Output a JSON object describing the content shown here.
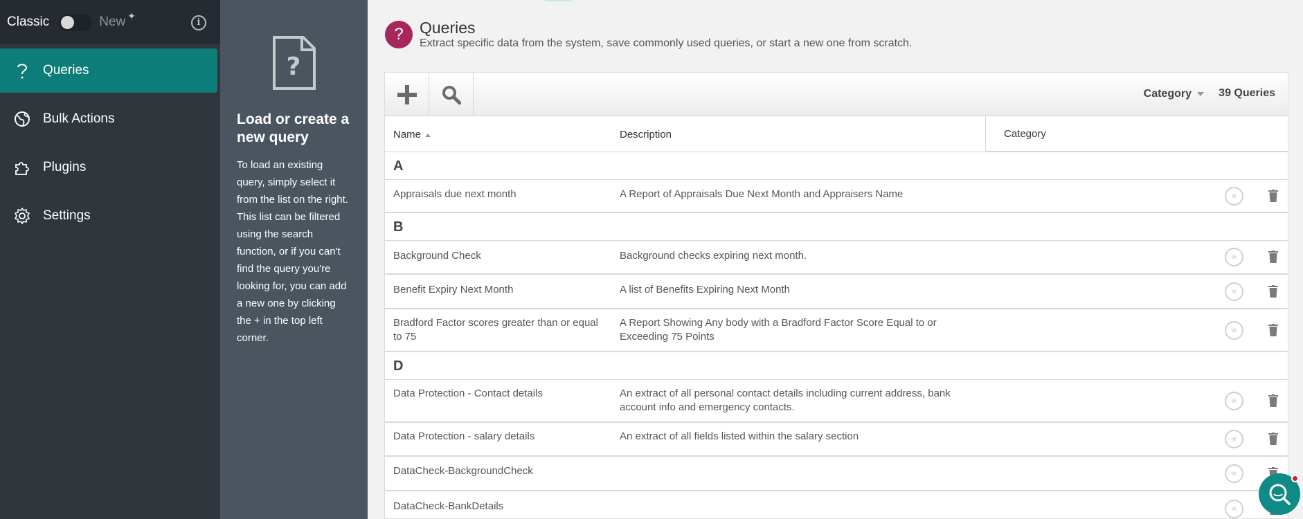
{
  "mode": {
    "classic_label": "Classic",
    "new_label": "New"
  },
  "nav": [
    {
      "label": "Queries",
      "icon": "question-icon",
      "active": true
    },
    {
      "label": "Bulk Actions",
      "icon": "globe-icon",
      "active": false
    },
    {
      "label": "Plugins",
      "icon": "puzzle-icon",
      "active": false
    },
    {
      "label": "Settings",
      "icon": "gear-icon",
      "active": false
    }
  ],
  "help": {
    "title": "Load or create a new query",
    "text": "To load an existing query, simply select it from the list on the right. This list can be filtered using the search function, or if you can't find the query you're looking for, you can add a new one by clicking the + in the top left corner."
  },
  "page": {
    "title": "Queries",
    "subtitle": "Extract specific data from the system, save commonly used queries, or start a new one from scratch."
  },
  "toolbar": {
    "category_label": "Category",
    "count_label": "39 Queries"
  },
  "columns": {
    "name": "Name",
    "description": "Description",
    "category": "Category"
  },
  "groups": [
    {
      "letter": "A",
      "rows": [
        {
          "name": "Appraisals due next month",
          "description": "A Report of Appraisals Due Next Month and Appraisers Name"
        }
      ]
    },
    {
      "letter": "B",
      "rows": [
        {
          "name": "Background Check",
          "description": "Background checks expiring next month."
        },
        {
          "name": "Benefit Expiry Next Month",
          "description": "A list of Benefits Expiring Next Month"
        },
        {
          "name": "Bradford Factor scores greater than or equal to 75",
          "description": "A Report Showing Any body with a Bradford Factor Score Equal to or Exceeding 75 Points"
        }
      ]
    },
    {
      "letter": "D",
      "rows": [
        {
          "name": "Data Protection - Contact details",
          "description": "An extract of all personal contact details including current address, bank account info and emergency contacts."
        },
        {
          "name": "Data Protection - salary details",
          "description": "An extract of all fields listed within the salary section"
        },
        {
          "name": "DataCheck-BackgroundCheck",
          "description": ""
        },
        {
          "name": "DataCheck-BankDetails",
          "description": ""
        }
      ]
    }
  ],
  "colors": {
    "accent": "#0d7d7a",
    "query_icon": "#a5275c",
    "sidebar": "#2f363c",
    "help_panel": "#4a5560"
  }
}
